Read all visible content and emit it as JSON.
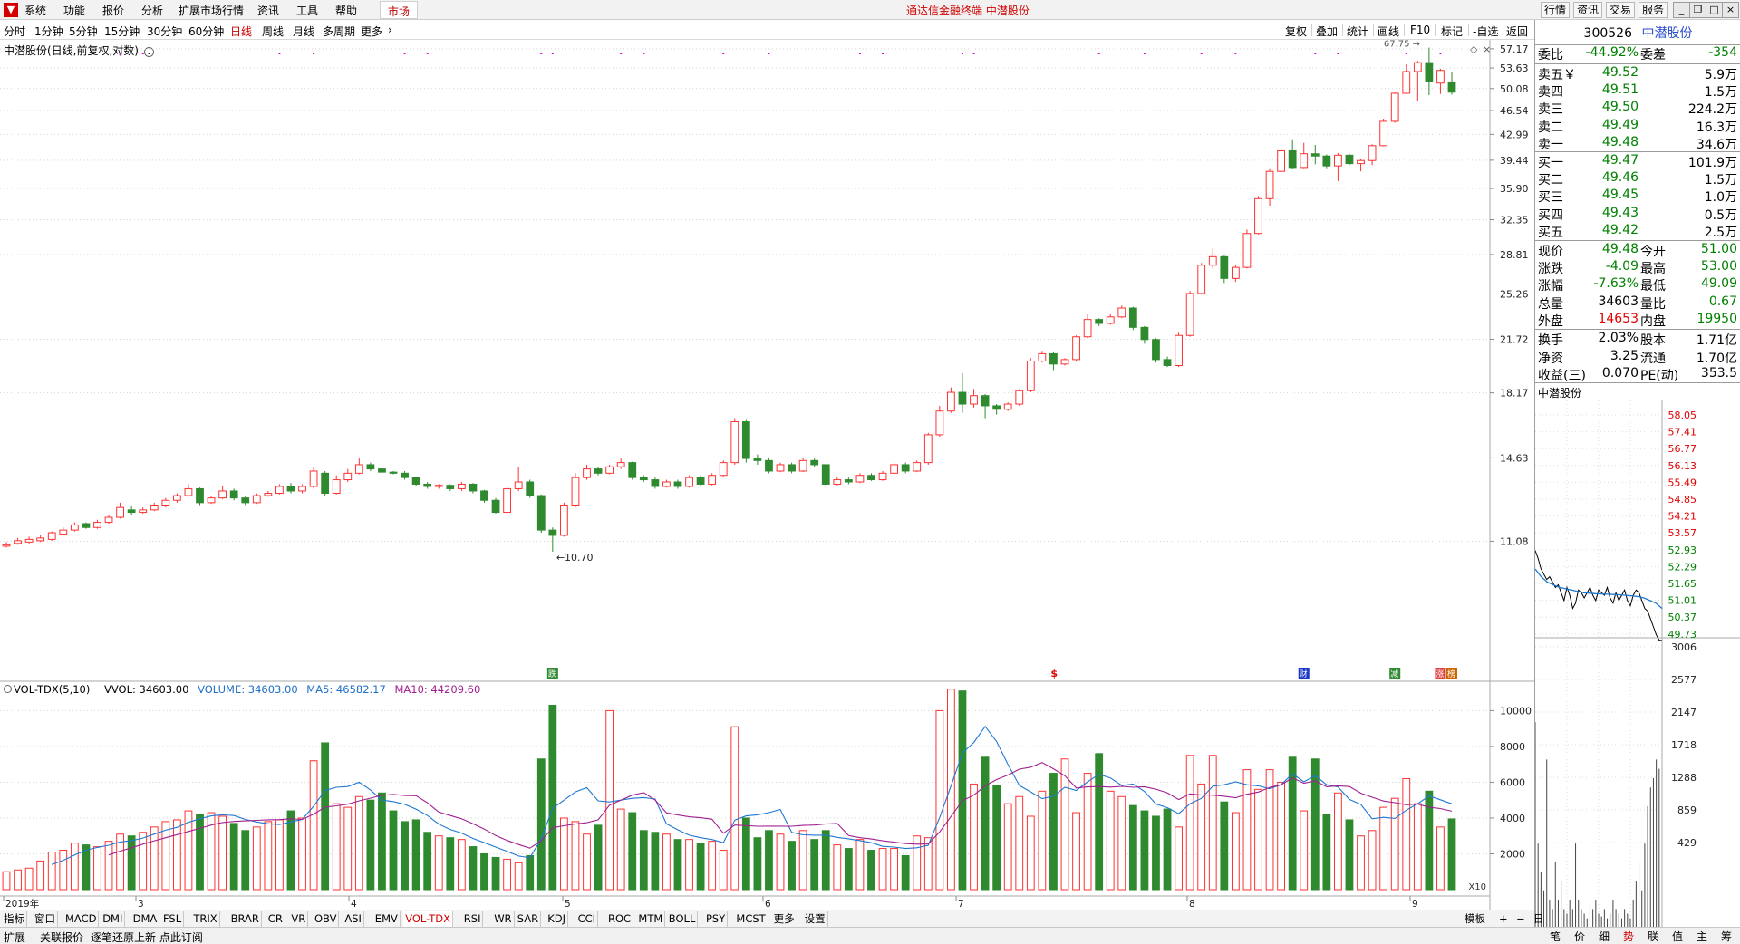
{
  "menu": {
    "logo": "▼",
    "items": [
      "系统",
      "功能",
      "报价",
      "分析",
      "扩展市场行情",
      "资讯",
      "工具",
      "帮助"
    ],
    "market_tab": "市场",
    "window_title": "通达信金融终端  中潜股份",
    "right_buttons": [
      "行情",
      "资讯",
      "交易",
      "服务"
    ],
    "window_controls": [
      "_",
      "❐",
      "□",
      "×"
    ]
  },
  "period_bar": {
    "periods": [
      "分时",
      "1分钟",
      "5分钟",
      "15分钟",
      "30分钟",
      "60分钟",
      "日线",
      "周线",
      "月线",
      "多周期",
      "更多"
    ],
    "active": "日线",
    "tools": [
      "复权",
      "叠加",
      "统计",
      "画线",
      "F10",
      "标记",
      "-自选",
      "返回"
    ]
  },
  "chart": {
    "title": "中潜股份(日线,前复权,对数)",
    "price_ticks": [
      "57.17",
      "53.63",
      "50.08",
      "46.54",
      "42.99",
      "39.44",
      "35.90",
      "32.35",
      "28.81",
      "25.26",
      "21.72",
      "18.17",
      "14.63",
      "11.08"
    ],
    "high_label": "67.75",
    "low_label": "10.70",
    "event_markers": [
      "跌",
      "$",
      "财",
      "减",
      "涨",
      "榜"
    ],
    "month_labels": [
      "2019年",
      "3",
      "4",
      "5",
      "6",
      "7",
      "8",
      "9"
    ],
    "vol_ticks": [
      "10000",
      "8000",
      "6000",
      "4000",
      "2000"
    ],
    "vol_unit": "X10",
    "colors": {
      "up": "#ff3232",
      "down": "#2f8a2f",
      "ma5": "#1e78d2",
      "ma10": "#a0208f"
    }
  },
  "chart_data": {
    "type": "candlestick",
    "scale": "log",
    "ylim": [
      10.7,
      57.5
    ],
    "candles": [
      [
        10.9,
        10.95,
        11.05,
        10.85
      ],
      [
        11.0,
        11.1,
        11.2,
        10.95
      ],
      [
        11.05,
        11.15,
        11.25,
        11.0
      ],
      [
        11.1,
        11.2,
        11.3,
        11.05
      ],
      [
        11.15,
        11.4,
        11.45,
        11.1
      ],
      [
        11.35,
        11.5,
        11.6,
        11.3
      ],
      [
        11.5,
        11.7,
        11.8,
        11.45
      ],
      [
        11.75,
        11.6,
        11.8,
        11.55
      ],
      [
        11.6,
        11.8,
        11.9,
        11.55
      ],
      [
        11.8,
        12.0,
        12.1,
        11.75
      ],
      [
        12.0,
        12.4,
        12.6,
        11.95
      ],
      [
        12.3,
        12.2,
        12.45,
        12.1
      ],
      [
        12.2,
        12.3,
        12.4,
        12.15
      ],
      [
        12.3,
        12.5,
        12.6,
        12.25
      ],
      [
        12.5,
        12.7,
        12.8,
        12.4
      ],
      [
        12.7,
        12.9,
        13.0,
        12.6
      ],
      [
        12.9,
        13.2,
        13.4,
        12.85
      ],
      [
        13.2,
        12.6,
        13.25,
        12.5
      ],
      [
        12.6,
        12.8,
        12.9,
        12.55
      ],
      [
        12.8,
        13.1,
        13.3,
        12.75
      ],
      [
        13.1,
        12.8,
        13.2,
        12.7
      ],
      [
        12.8,
        12.6,
        12.9,
        12.5
      ],
      [
        12.6,
        12.9,
        13.0,
        12.55
      ],
      [
        12.9,
        13.0,
        13.1,
        12.85
      ],
      [
        13.0,
        13.3,
        13.4,
        12.95
      ],
      [
        13.3,
        13.1,
        13.45,
        13.0
      ],
      [
        13.1,
        13.3,
        13.4,
        13.0
      ],
      [
        13.3,
        14.0,
        14.2,
        13.2
      ],
      [
        13.9,
        13.0,
        14.0,
        12.9
      ],
      [
        13.0,
        13.6,
        13.8,
        12.95
      ],
      [
        13.6,
        13.9,
        14.1,
        13.5
      ],
      [
        13.9,
        14.3,
        14.6,
        13.85
      ],
      [
        14.3,
        14.1,
        14.4,
        14.0
      ],
      [
        14.1,
        13.95,
        14.15,
        13.9
      ],
      [
        13.95,
        13.9,
        14.0,
        13.85
      ],
      [
        13.9,
        13.7,
        14.0,
        13.6
      ],
      [
        13.7,
        13.4,
        13.75,
        13.3
      ],
      [
        13.4,
        13.3,
        13.5,
        13.2
      ],
      [
        13.3,
        13.35,
        13.4,
        13.2
      ],
      [
        13.35,
        13.2,
        13.4,
        13.1
      ],
      [
        13.2,
        13.4,
        13.5,
        13.1
      ],
      [
        13.4,
        13.1,
        13.45,
        13.0
      ],
      [
        13.1,
        12.7,
        13.15,
        12.6
      ],
      [
        12.7,
        12.2,
        12.8,
        12.15
      ],
      [
        12.2,
        13.2,
        13.3,
        12.15
      ],
      [
        13.2,
        13.5,
        14.2,
        13.1
      ],
      [
        13.5,
        12.9,
        13.6,
        12.8
      ],
      [
        12.9,
        11.5,
        12.95,
        11.4
      ],
      [
        11.5,
        11.3,
        11.6,
        10.7
      ],
      [
        11.3,
        12.5,
        12.6,
        11.25
      ],
      [
        12.5,
        13.7,
        13.9,
        12.4
      ],
      [
        13.7,
        14.1,
        14.3,
        13.6
      ],
      [
        14.1,
        13.9,
        14.2,
        13.8
      ],
      [
        13.9,
        14.2,
        14.3,
        13.85
      ],
      [
        14.2,
        14.4,
        14.6,
        14.1
      ],
      [
        14.4,
        13.7,
        14.45,
        13.6
      ],
      [
        13.7,
        13.6,
        13.8,
        13.5
      ],
      [
        13.6,
        13.3,
        13.7,
        13.2
      ],
      [
        13.3,
        13.5,
        13.6,
        13.25
      ],
      [
        13.5,
        13.3,
        13.6,
        13.2
      ],
      [
        13.3,
        13.7,
        13.8,
        13.25
      ],
      [
        13.7,
        13.4,
        13.8,
        13.3
      ],
      [
        13.4,
        13.8,
        13.9,
        13.35
      ],
      [
        13.8,
        14.4,
        14.5,
        13.75
      ],
      [
        14.4,
        16.5,
        16.7,
        14.3
      ],
      [
        16.5,
        14.6,
        16.6,
        14.4
      ],
      [
        14.6,
        14.5,
        14.8,
        14.3
      ],
      [
        14.5,
        14.0,
        14.6,
        13.9
      ],
      [
        14.0,
        14.3,
        14.4,
        13.95
      ],
      [
        14.3,
        14.0,
        14.4,
        13.9
      ],
      [
        14.0,
        14.5,
        14.6,
        13.95
      ],
      [
        14.5,
        14.3,
        14.6,
        14.2
      ],
      [
        14.3,
        13.4,
        14.35,
        13.3
      ],
      [
        13.4,
        13.6,
        13.7,
        13.35
      ],
      [
        13.6,
        13.5,
        13.7,
        13.4
      ],
      [
        13.5,
        13.8,
        13.9,
        13.45
      ],
      [
        13.8,
        13.6,
        13.9,
        13.55
      ],
      [
        13.6,
        13.9,
        14.0,
        13.55
      ],
      [
        13.9,
        14.3,
        14.4,
        13.85
      ],
      [
        14.3,
        14.0,
        14.4,
        13.9
      ],
      [
        14.0,
        14.4,
        14.5,
        13.95
      ],
      [
        14.4,
        15.8,
        15.9,
        14.3
      ],
      [
        15.8,
        17.1,
        17.4,
        15.7
      ],
      [
        17.1,
        18.2,
        18.5,
        17.0
      ],
      [
        18.2,
        17.5,
        19.4,
        17.0
      ],
      [
        17.5,
        18.0,
        18.4,
        17.3
      ],
      [
        18.0,
        17.4,
        18.1,
        16.7
      ],
      [
        17.4,
        17.2,
        17.5,
        16.9
      ],
      [
        17.2,
        17.5,
        17.6,
        17.1
      ],
      [
        17.5,
        18.3,
        18.4,
        17.4
      ],
      [
        18.3,
        20.2,
        20.4,
        18.2
      ],
      [
        20.2,
        20.7,
        20.9,
        20.1
      ],
      [
        20.7,
        20.0,
        20.8,
        19.6
      ],
      [
        20.0,
        20.3,
        20.4,
        19.9
      ],
      [
        20.3,
        21.9,
        22.0,
        20.2
      ],
      [
        21.9,
        23.2,
        23.6,
        21.8
      ],
      [
        23.2,
        22.9,
        23.3,
        22.7
      ],
      [
        22.9,
        23.4,
        23.6,
        22.8
      ],
      [
        23.4,
        24.1,
        24.3,
        23.3
      ],
      [
        24.1,
        22.6,
        24.2,
        22.4
      ],
      [
        22.6,
        21.7,
        22.7,
        21.4
      ],
      [
        21.7,
        20.3,
        21.8,
        20.1
      ],
      [
        20.3,
        19.9,
        20.5,
        19.8
      ],
      [
        19.9,
        22.0,
        22.2,
        19.8
      ],
      [
        22.0,
        25.3,
        25.5,
        21.9
      ],
      [
        25.3,
        27.8,
        28.0,
        25.2
      ],
      [
        27.8,
        28.6,
        29.4,
        27.5
      ],
      [
        28.6,
        26.6,
        28.7,
        26.2
      ],
      [
        26.6,
        27.6,
        27.8,
        26.3
      ],
      [
        27.6,
        30.9,
        31.3,
        27.5
      ],
      [
        30.9,
        34.7,
        35.0,
        30.8
      ],
      [
        34.7,
        38.0,
        38.4,
        33.9
      ],
      [
        38.0,
        40.7,
        40.9,
        37.9
      ],
      [
        40.7,
        38.5,
        42.3,
        38.3
      ],
      [
        38.5,
        40.3,
        41.8,
        38.4
      ],
      [
        40.3,
        40.0,
        41.5,
        38.9
      ],
      [
        40.0,
        38.7,
        40.2,
        38.4
      ],
      [
        38.7,
        40.1,
        40.4,
        36.8
      ],
      [
        40.1,
        39.0,
        40.3,
        38.8
      ],
      [
        39.0,
        39.4,
        39.6,
        38.0
      ],
      [
        39.4,
        41.4,
        41.6,
        38.8
      ],
      [
        41.4,
        44.9,
        45.3,
        41.3
      ],
      [
        44.9,
        49.3,
        49.5,
        44.7
      ],
      [
        49.3,
        53.0,
        54.3,
        49.2
      ],
      [
        53.0,
        54.6,
        54.9,
        48.0
      ],
      [
        54.6,
        51.2,
        57.4,
        49.0
      ],
      [
        51.0,
        53.2,
        53.5,
        49.2
      ],
      [
        51.2,
        49.48,
        53.0,
        49.09
      ]
    ],
    "volume": [
      820,
      1050,
      1150,
      1350,
      1700,
      1900,
      2100,
      2300,
      2500,
      2800,
      3050,
      2900,
      3000,
      3200,
      3500,
      3650,
      3750,
      3700,
      3600,
      3800,
      3500,
      3300,
      3100,
      2950,
      3100,
      3200,
      3050,
      3100,
      3300,
      3600,
      4000,
      4200,
      4400,
      4300,
      4100,
      3950,
      3750,
      3550,
      3300,
      3100,
      2900,
      2700,
      2500,
      2300,
      2200,
      2150,
      2150,
      2200,
      2400,
      3000,
      3950,
      4800,
      5100,
      5250,
      5300,
      5350,
      5450,
      5550,
      5650,
      5750,
      5850,
      5900,
      5950,
      5950,
      5850,
      5650,
      5450,
      5250,
      5000,
      4800,
      4600,
      4450,
      4400,
      4500,
      4650,
      4800,
      4900,
      4950,
      4850,
      4600,
      4450,
      4400,
      4450,
      4600,
      4900,
      5200,
      5450,
      5650,
      5800,
      5900,
      5950,
      5900,
      5800,
      5700,
      5600,
      5550,
      5500,
      5450,
      5400,
      5350,
      5350,
      5400,
      5450,
      5500,
      5550,
      5550,
      5500,
      5450,
      5400,
      5350,
      5300,
      5200,
      5100,
      5000,
      4900,
      4800,
      4750,
      4700,
      4650,
      4600,
      4550,
      4500,
      4400,
      4400,
      4400,
      4500,
      4450,
      4400
    ],
    "vol_ylim": [
      0,
      11000
    ],
    "vol_series": [
      [
        1000,
        1100,
        1200,
        1600,
        2100,
        2200,
        2600,
        2500,
        2400,
        2700,
        3100,
        3000,
        3200,
        3500,
        3800,
        3900,
        4400,
        4200,
        4300,
        4100,
        3700,
        3300,
        3500,
        3800,
        3900,
        4400,
        4000,
        7200,
        8200,
        4800,
        4600,
        5200,
        5000,
        5400,
        4400,
        3800,
        3900,
        3200,
        3000,
        2900,
        2800,
        2400,
        2000,
        1800,
        1700,
        1500,
        1900,
        7300,
        10300,
        4000,
        3800,
        3100,
        3600,
        10000,
        4500,
        4300,
        3300,
        3200,
        3100,
        2800,
        2800,
        2600,
        2700,
        2200,
        9100,
        4000,
        2900,
        3300,
        3100,
        2700,
        3300,
        2800,
        3300,
        2500,
        2300,
        2800,
        2200,
        2300,
        2300,
        1900,
        3000,
        2900,
        10000,
        11200,
        11100,
        5900,
        7400,
        5800,
        4800,
        5200,
        4100,
        5500,
        6500,
        7300,
        4300,
        6500,
        7600,
        5500,
        5200,
        4700,
        4400,
        4100,
        4500,
        3500,
        7500,
        5900,
        7500,
        4900,
        4300,
        6700,
        5600,
        6700,
        6000,
        7400,
        4400,
        7300,
        4200,
        5400,
        3900,
        3000,
        3300,
        4600,
        5100,
        6200,
        4800,
        5500,
        3500,
        3950
      ],
      [
        1000,
        1050,
        1100,
        1300,
        1600,
        1800,
        2100,
        2300,
        2400,
        2500,
        2700,
        2800,
        2950,
        3100,
        3300,
        3500,
        3700,
        3800,
        3900,
        3950,
        3800,
        3650,
        3550,
        3600,
        3650,
        3750,
        3700,
        4300,
        4900,
        5100,
        5000,
        4900,
        4800,
        4700,
        4500,
        4200,
        3900,
        3600,
        3400,
        3200,
        3000,
        2800,
        2600,
        2400,
        2200,
        2000,
        2300,
        3200,
        4600,
        5200,
        5400,
        5500,
        5600,
        6200,
        6300,
        6100,
        5700,
        5200,
        4800,
        4400,
        4100,
        3800,
        3600,
        3400,
        4000,
        4700,
        5200,
        5400,
        5300,
        4900,
        4400,
        4000,
        3700,
        3500,
        3300,
        3100,
        3000,
        2900,
        2800,
        2700,
        2700,
        3200,
        4300,
        5700,
        6800,
        7900,
        8000,
        7500,
        6600,
        5800,
        5300,
        5000,
        5000,
        5200,
        5400,
        5500,
        5600,
        5700,
        5800,
        5700,
        5500,
        5300,
        5100,
        4900,
        5000,
        5200,
        5400,
        5500,
        5600,
        5700,
        5800,
        5900,
        6000,
        6000,
        6000,
        5900,
        5700,
        5500,
        5300,
        5000,
        4800,
        4600,
        4500,
        4500,
        4600,
        4700,
        4750,
        4750
      ]
    ],
    "vol_last": "34603.00",
    "ma5_last": "46582.17",
    "ma10_last": "44209.60"
  },
  "vol_header": {
    "indicator": "VOL-TDX(5,10)",
    "vvol": "VVOL: 34603.00",
    "volume": "VOLUME: 34603.00",
    "ma5": "MA5: 46582.17",
    "ma10": "MA10: 44209.60"
  },
  "bottom_tabs": [
    "指标",
    "窗口",
    "MACD",
    "DMI",
    "DMA",
    "FSL",
    "TRIX",
    "BRAR",
    "CR",
    "VR",
    "OBV",
    "ASI",
    "EMV",
    "VOL-TDX",
    "RSI",
    "WR",
    "SAR",
    "KDJ",
    "CCI",
    "ROC",
    "MTM",
    "BOLL",
    "PSY",
    "MCST",
    "更多",
    "设置"
  ],
  "bottom_active": "VOL-TDX",
  "bottom_right": [
    "模板",
    "+",
    "−",
    "日线"
  ],
  "status": {
    "left": "扩展",
    "mid": "关联报价",
    "msg": "逐笔还原上新 点此订阅"
  },
  "quote": {
    "code": "300526",
    "name": "中潜股份",
    "weibi_label": "委比",
    "weibi": "-44.92%",
    "weicha_label": "委差",
    "weicha": "-354",
    "asks": [
      {
        "label": "卖五￥",
        "price": "49.52",
        "vol": "5.9万"
      },
      {
        "label": "卖四",
        "price": "49.51",
        "vol": "1.5万"
      },
      {
        "label": "卖三",
        "price": "49.50",
        "vol": "224.2万"
      },
      {
        "label": "卖二",
        "price": "49.49",
        "vol": "16.3万"
      },
      {
        "label": "卖一",
        "price": "49.48",
        "vol": "34.6万"
      }
    ],
    "bids": [
      {
        "label": "买一",
        "price": "49.47",
        "vol": "101.9万"
      },
      {
        "label": "买二",
        "price": "49.46",
        "vol": "1.5万"
      },
      {
        "label": "买三",
        "price": "49.45",
        "vol": "1.0万"
      },
      {
        "label": "买四",
        "price": "49.43",
        "vol": "0.5万"
      },
      {
        "label": "买五",
        "price": "49.42",
        "vol": "2.5万"
      }
    ],
    "stats": [
      {
        "l1": "现价",
        "v1": "49.48",
        "c1": "green",
        "l2": "今开",
        "v2": "51.00",
        "c2": "green"
      },
      {
        "l1": "涨跌",
        "v1": "-4.09",
        "c1": "green",
        "l2": "最高",
        "v2": "53.00",
        "c2": "green"
      },
      {
        "l1": "涨幅",
        "v1": "-7.63%",
        "c1": "green",
        "l2": "最低",
        "v2": "49.09",
        "c2": "green"
      },
      {
        "l1": "总量",
        "v1": "34603",
        "c1": "black",
        "l2": "量比",
        "v2": "0.67",
        "c2": "green"
      },
      {
        "l1": "外盘",
        "v1": "14653",
        "c1": "red",
        "l2": "内盘",
        "v2": "19950",
        "c2": "green"
      }
    ],
    "stats2": [
      {
        "l1": "换手",
        "v1": "2.03%",
        "l2": "股本",
        "v2": "1.71亿"
      },
      {
        "l1": "净资",
        "v1": "3.25",
        "l2": "流通",
        "v2": "1.70亿"
      },
      {
        "l1": "收益(三)",
        "v1": "0.070",
        "l2": "PE(动)",
        "v2": "353.5"
      }
    ],
    "mini_title": "中潜股份",
    "mini_price_ticks": [
      "58.05",
      "57.41",
      "56.77",
      "56.13",
      "55.49",
      "54.85",
      "54.21",
      "53.57",
      "52.93",
      "52.29",
      "51.65",
      "51.01",
      "50.37",
      "49.73"
    ],
    "mini_vol_ticks": [
      "3006",
      "2577",
      "2147",
      "1718",
      "1288",
      "859",
      "429"
    ],
    "right_tabs": [
      "笔",
      "价",
      "细",
      "势",
      "联",
      "值",
      "主",
      "筹"
    ],
    "right_tab_active": "势"
  }
}
